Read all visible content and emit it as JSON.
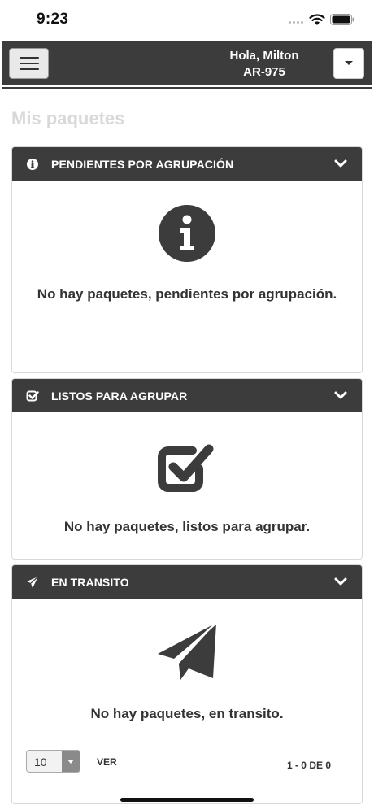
{
  "status_bar": {
    "time": "9:23"
  },
  "header": {
    "greeting": "Hola, Milton",
    "user_code": "AR-975"
  },
  "page": {
    "title": "Mis paquetes"
  },
  "panels": [
    {
      "title": "PENDIENTES POR AGRUPACIÓN",
      "icon": "info-circle-icon",
      "empty_message": "No hay paquetes, pendientes por agrupación."
    },
    {
      "title": "LISTOS PARA AGRUPAR",
      "icon": "check-square-icon",
      "empty_message": "No hay paquetes, listos para agrupar."
    },
    {
      "title": "EN TRANSITO",
      "icon": "paper-plane-icon",
      "empty_message": "No hay paquetes, en transito."
    }
  ],
  "pagination": {
    "page_size": "10",
    "ver_label": "VER",
    "range": "1 - 0 DE 0"
  },
  "colors": {
    "header_bg": "#3c3c3c",
    "title_muted": "#d9d9d9",
    "text": "#333333"
  }
}
